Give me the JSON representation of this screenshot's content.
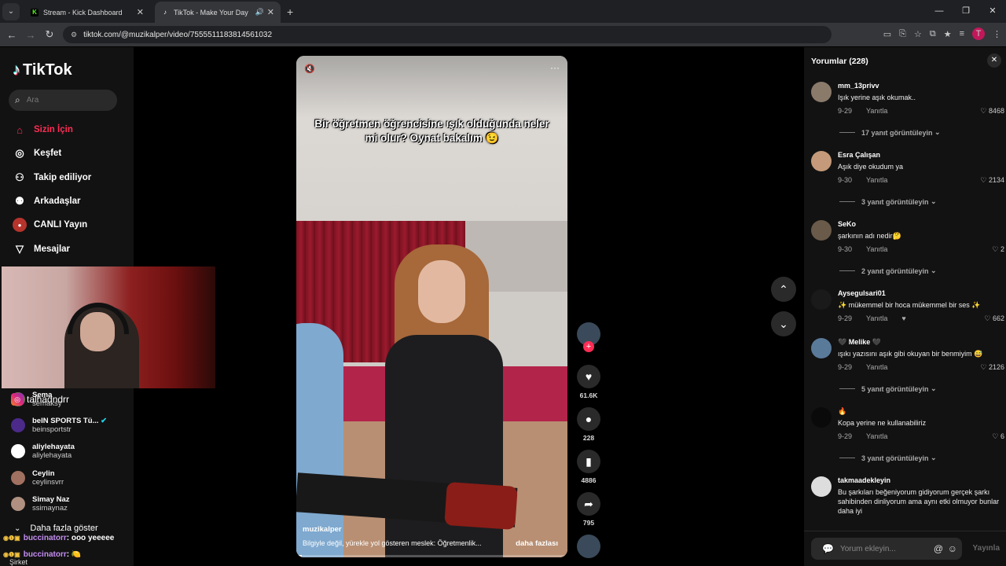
{
  "browser": {
    "tabs": [
      {
        "title": "Stream - Kick Dashboard",
        "fav": "K",
        "fav_color": "#53fc18"
      },
      {
        "title": "TikTok - Make Your Day",
        "fav": "♪",
        "fav_color": "#000000"
      }
    ],
    "url": "tiktok.com/@muzikalper/video/7555511183814561032",
    "profile_initial": "T"
  },
  "sidebar": {
    "brand": "TikTok",
    "search_placeholder": "Ara",
    "nav": [
      {
        "label": "Sizin İçin",
        "icon": "home-icon"
      },
      {
        "label": "Keşfet",
        "icon": "compass-icon"
      },
      {
        "label": "Takip ediliyor",
        "icon": "following-icon"
      },
      {
        "label": "Arkadaşlar",
        "icon": "friends-icon"
      },
      {
        "label": "CANLI Yayın",
        "icon": "live-icon"
      },
      {
        "label": "Mesajlar",
        "icon": "messages-icon"
      }
    ],
    "overlay_handle": "talhadndrr",
    "following": [
      {
        "name": "Sema",
        "handle": "semaksy"
      },
      {
        "name": "beIN SPORTS Tü...",
        "handle": "beinsportstr"
      },
      {
        "name": "aliylehayata",
        "handle": "aliylehayata"
      },
      {
        "name": "Ceylin",
        "handle": "ceylinsvrr"
      },
      {
        "name": "Simay Naz",
        "handle": "ssimaynaz"
      }
    ],
    "show_more": "Daha fazla göster",
    "chat": [
      {
        "user": "buccinatorr",
        "msg": ": ooo yeeeee"
      },
      {
        "user": "buccinatorr",
        "msg": ": 🍋"
      }
    ],
    "footer_label": "Şirket"
  },
  "video": {
    "caption": "Bir öğretmen öğrencisine ışık olduğunda neler mi olur? Oynat bakalım 😉",
    "author": "muzikalper",
    "description": "Bilgiyle değil, yürekle yol gösteren meslek: Öğretmenlik...",
    "more_label": "daha fazlası",
    "progress": 0.02
  },
  "actions": {
    "likes": "61.6K",
    "comments": "228",
    "saves": "4886",
    "shares": "795"
  },
  "comments": {
    "title": "Yorumlar (228)",
    "reply_label": "Yanıtla",
    "items": [
      {
        "name": "mm_13privv",
        "text": "Işık yerine aşık okumak..",
        "date": "9-29",
        "likes": "8468",
        "replies": "17 yanıt görüntüleyin",
        "av": "#8a7a6a"
      },
      {
        "name": "Esra Çalışan",
        "text": "Aşık diye okudum ya",
        "date": "9-30",
        "likes": "2134",
        "replies": "3 yanıt görüntüleyin",
        "av": "#c49a7a"
      },
      {
        "name": "SeKo",
        "text": "şarkının adı nedir🤔",
        "date": "9-30",
        "likes": "2",
        "replies": "2 yanıt görüntüleyin",
        "av": "#6a5a4a"
      },
      {
        "name": "Aysegulsari01",
        "text": "✨ mükemmel bir hoca mükemmel bir ses ✨",
        "date": "9-29",
        "likes": "662",
        "replies": "",
        "av": "#1a1a1a"
      },
      {
        "name": "🖤 Melike 🖤",
        "text": "ışıkı yazısını aşık gibi okuyan bir benmiyim 😅",
        "date": "9-29",
        "likes": "2126",
        "replies": "5 yanıt görüntüleyin",
        "av": "#5a7a9a"
      },
      {
        "name": "🔥",
        "text": "Kopa yerine ne kullanabiliriz",
        "date": "9-29",
        "likes": "6",
        "replies": "3 yanıt görüntüleyin",
        "av": "#0a0a0a"
      },
      {
        "name": "takmaadekleyin",
        "text": "Bu şarkıları beğeniyorum gidiyorum gerçek şarkı sahibinden dinliyorum ama aynı etki olmuyor bunlar daha iyi",
        "date": "",
        "likes": "",
        "replies": "",
        "av": "#dddddd"
      }
    ],
    "input_placeholder": "Yorum ekleyin...",
    "post_label": "Yayınla"
  }
}
